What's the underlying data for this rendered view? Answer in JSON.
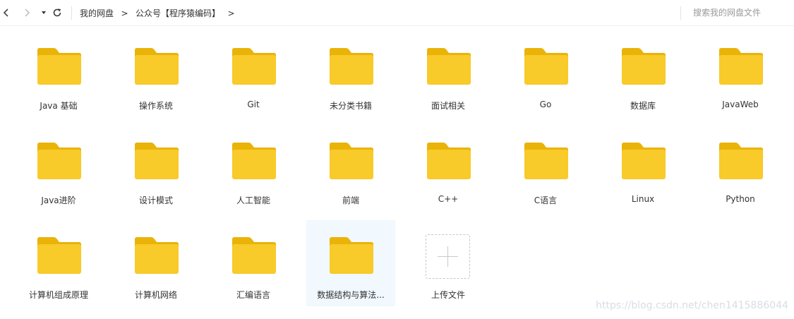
{
  "breadcrumbs": [
    "我的网盘",
    "公众号【程序猿编码】"
  ],
  "breadcrumb_separator": ">",
  "search": {
    "placeholder": "搜索我的网盘文件",
    "value": ""
  },
  "folders": [
    "Java 基础",
    "操作系统",
    "Git",
    "未分类书籍",
    "面试相关",
    "Go",
    "数据库",
    "JavaWeb",
    "Java进阶",
    "设计模式",
    "人工智能",
    "前端",
    "C++",
    "C语言",
    "Linux",
    "Python",
    "计算机组成原理",
    "计算机网络",
    "汇编语言",
    "数据结构与算法..."
  ],
  "selected_folder_index": 19,
  "upload_label": "上传文件",
  "watermark": "https://blog.csdn.net/chen1415886044",
  "colors": {
    "folder_body": "#f8ca2a",
    "folder_tab": "#eab308",
    "selected_bg": "#f1f8fe"
  },
  "icons": {
    "back": "chevron-left-icon",
    "forward": "chevron-right-icon",
    "history": "caret-down-icon",
    "refresh": "refresh-icon",
    "folder": "folder-icon",
    "upload": "plus-icon"
  }
}
